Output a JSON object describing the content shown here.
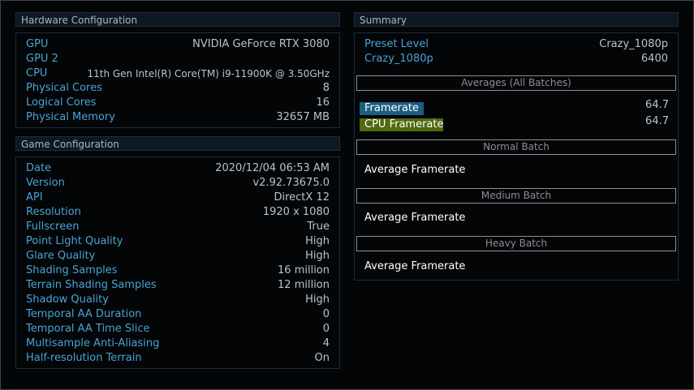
{
  "hardware": {
    "title": "Hardware Configuration",
    "rows": [
      {
        "label": "GPU",
        "value": "NVIDIA GeForce RTX 3080"
      },
      {
        "label": "GPU 2",
        "value": ""
      },
      {
        "label": "CPU",
        "value": "11th Gen Intel(R) Core(TM) i9-11900K @ 3.50GHz"
      },
      {
        "label": "Physical Cores",
        "value": "8"
      },
      {
        "label": "Logical Cores",
        "value": "16"
      },
      {
        "label": "Physical Memory",
        "value": "32657 MB"
      }
    ]
  },
  "game": {
    "title": "Game Configuration",
    "rows": [
      {
        "label": "Date",
        "value": "2020/12/04 06:53 AM"
      },
      {
        "label": "Version",
        "value": "v2.92.73675.0"
      },
      {
        "label": "API",
        "value": "DirectX 12"
      },
      {
        "label": "Resolution",
        "value": "1920 x 1080"
      },
      {
        "label": "Fullscreen",
        "value": "True"
      },
      {
        "label": "Point Light Quality",
        "value": "High"
      },
      {
        "label": "Glare Quality",
        "value": "High"
      },
      {
        "label": "Shading Samples",
        "value": "16 million"
      },
      {
        "label": "Terrain Shading Samples",
        "value": "12 million"
      },
      {
        "label": "Shadow Quality",
        "value": "High"
      },
      {
        "label": "Temporal AA Duration",
        "value": "0"
      },
      {
        "label": "Temporal AA Time Slice",
        "value": "0"
      },
      {
        "label": "Multisample Anti-Aliasing",
        "value": "4"
      },
      {
        "label": "Half-resolution Terrain",
        "value": "On"
      }
    ]
  },
  "summary": {
    "title": "Summary",
    "rows": [
      {
        "label": "Preset Level",
        "value": "Crazy_1080p"
      },
      {
        "label": "Crazy_1080p",
        "value": "6400"
      }
    ],
    "averages_title": "Averages (All Batches)",
    "framerate_label": "Framerate",
    "framerate_value": "64.7",
    "cpu_framerate_label": "CPU Framerate",
    "cpu_framerate_value": "64.7",
    "batches": [
      {
        "title": "Normal Batch",
        "label": "Average Framerate"
      },
      {
        "title": "Medium Batch",
        "label": "Average Framerate"
      },
      {
        "title": "Heavy Batch",
        "label": "Average Framerate"
      }
    ]
  },
  "colors": {
    "label_blue": "#4aa3d6",
    "value_grey": "#b9c4cc",
    "framerate_bar": "#1b5e80",
    "cpu_framerate_bar": "#4f6a10"
  }
}
